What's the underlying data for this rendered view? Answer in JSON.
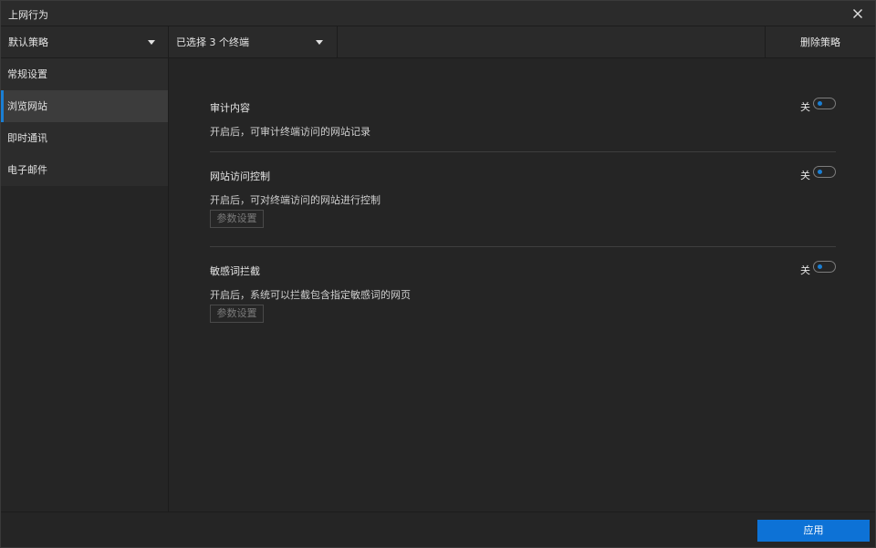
{
  "window": {
    "title": "上网行为"
  },
  "toolbar": {
    "policy_dropdown": {
      "selected": "默认策略"
    },
    "terminal_dropdown": {
      "selected": "已选择 3 个终端"
    },
    "delete_label": "删除策略"
  },
  "sidebar": {
    "items": [
      {
        "label": "常规设置",
        "active": false
      },
      {
        "label": "浏览网站",
        "active": true
      },
      {
        "label": "即时通讯",
        "active": false
      },
      {
        "label": "电子邮件",
        "active": false
      }
    ]
  },
  "main": {
    "sections": [
      {
        "title": "审计内容",
        "description": "开启后，可审计终端访问的网站记录",
        "toggle_state": "关",
        "enabled": false
      },
      {
        "title": "网站访问控制",
        "description": "开启后，可对终端访问的网站进行控制",
        "toggle_state": "关",
        "enabled": false,
        "button_label": "参数设置"
      },
      {
        "title": "敏感词拦截",
        "description": "开启后，系统可以拦截包含指定敏感词的网页",
        "toggle_state": "关",
        "enabled": false,
        "button_label": "参数设置"
      }
    ]
  },
  "footer": {
    "apply_label": "应用"
  },
  "colors": {
    "accent": "#0d72d6",
    "background": "#252525",
    "toggle_knob": "#1a7fd4"
  },
  "icons": {
    "close": "close-icon",
    "caret": "caret-down-icon"
  }
}
